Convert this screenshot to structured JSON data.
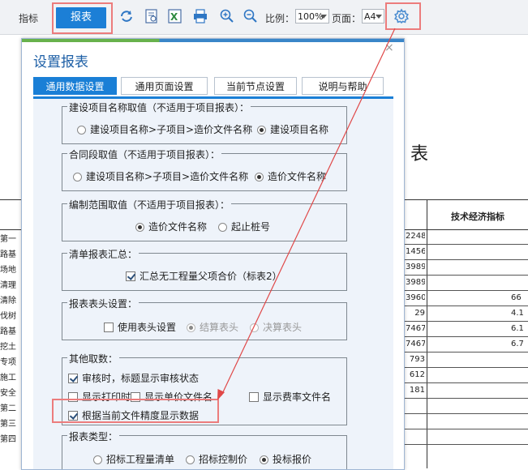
{
  "toolbar": {
    "tab_indicator": "指标",
    "report_button": "报表",
    "scale_label": "比例：",
    "scale_value": "100%",
    "page_label": "页面：",
    "page_value": "A4"
  },
  "background": {
    "title_char": "表",
    "column_header": "技术经济指标",
    "left_cells": [
      "第一",
      "路基",
      "场地",
      "清理",
      "清除",
      "伐树",
      "路基",
      "挖土",
      "专项",
      "施工",
      "安全",
      "第二",
      "第三",
      "第四"
    ],
    "value_cells": [
      "2248",
      "1456",
      "3989",
      "3989",
      "3960",
      "29",
      "7467",
      "7467",
      "793",
      "612",
      "181"
    ],
    "right_cells": [
      "",
      "",
      "",
      "",
      "66",
      "4.1",
      "6.1",
      "6.7"
    ]
  },
  "dialog": {
    "title": "设置报表",
    "close": "×",
    "tabs": [
      "通用数据设置",
      "通用页面设置",
      "当前节点设置",
      "说明与帮助"
    ],
    "active_tab": 0,
    "groups": {
      "project_name": {
        "title": "建设项目名称取值（不适用于项目报表）：",
        "options": [
          "建设项目名称>子项目>造价文件名称",
          "建设项目名称"
        ],
        "selected": 1
      },
      "contract": {
        "title": "合同段取值（不适用于项目报表）：",
        "options": [
          "建设项目名称>子项目>造价文件名称",
          "造价文件名称"
        ],
        "selected": 1
      },
      "scope": {
        "title": "编制范围取值（不适用于项目报表）：",
        "options": [
          "造价文件名称",
          "起止桩号"
        ],
        "selected": 0
      },
      "summary": {
        "title": "清单报表汇总：",
        "checkbox": "汇总无工程量父项合价（标表2）",
        "checked": true
      },
      "header": {
        "title": "报表表头设置：",
        "checkbox": "使用表头设置",
        "checked": false,
        "options": [
          "结算表头",
          "决算表头"
        ],
        "selected": 0
      },
      "other": {
        "title": "其他取数：",
        "audit": "审核时，标题显示审核状态",
        "audit_checked": true,
        "print_time": "显示打印时间",
        "unit_price_file": "显示单价文件名",
        "rate_file": "显示费率文件名",
        "precision": "根据当前文件精度显示数据",
        "precision_checked": true
      },
      "report_type": {
        "title": "报表类型：",
        "options": [
          "招标工程量清单",
          "招标控制价",
          "投标报价"
        ],
        "selected": 2
      }
    }
  },
  "colors": {
    "accent": "#1a7fd6",
    "annotation": "#e04848"
  }
}
